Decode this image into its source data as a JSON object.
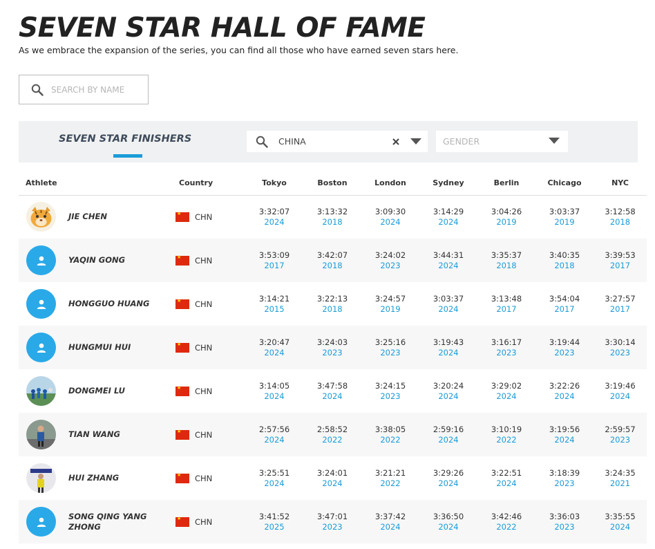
{
  "header": {
    "title": "SEVEN STAR HALL OF FAME",
    "subtitle": "As we embrace the expansion of the series, you can find all those who have earned seven stars here."
  },
  "search": {
    "placeholder": "SEARCH BY NAME",
    "icon": "search-icon"
  },
  "filters": {
    "section_tab": "SEVEN STAR FINISHERS",
    "country": {
      "value": "CHINA",
      "icon": "search-icon"
    },
    "gender": {
      "placeholder": "GENDER"
    }
  },
  "colors": {
    "accent": "#1a9cd8",
    "avatar_default": "#2aa9e8",
    "flag_red": "#de2910"
  },
  "table": {
    "headers": {
      "athlete": "Athlete",
      "country": "Country",
      "tokyo": "Tokyo",
      "boston": "Boston",
      "london": "London",
      "sydney": "Sydney",
      "berlin": "Berlin",
      "chicago": "Chicago",
      "nyc": "NYC"
    },
    "rows": [
      {
        "name": "JIE CHEN",
        "avatar": "tiger-avatar",
        "country": "CHN",
        "results": [
          {
            "time": "3:32:07",
            "year": "2024"
          },
          {
            "time": "3:13:32",
            "year": "2018"
          },
          {
            "time": "3:09:30",
            "year": "2024"
          },
          {
            "time": "3:14:29",
            "year": "2024"
          },
          {
            "time": "3:04:26",
            "year": "2019"
          },
          {
            "time": "3:03:37",
            "year": "2019"
          },
          {
            "time": "3:12:58",
            "year": "2018"
          }
        ]
      },
      {
        "name": "YAQIN GONG",
        "avatar": "default-user-avatar",
        "country": "CHN",
        "results": [
          {
            "time": "3:53:09",
            "year": "2017"
          },
          {
            "time": "3:42:07",
            "year": "2018"
          },
          {
            "time": "3:24:02",
            "year": "2023"
          },
          {
            "time": "3:44:31",
            "year": "2024"
          },
          {
            "time": "3:35:37",
            "year": "2018"
          },
          {
            "time": "3:40:35",
            "year": "2018"
          },
          {
            "time": "3:39:53",
            "year": "2017"
          }
        ]
      },
      {
        "name": "HONGGUO HUANG",
        "avatar": "default-user-avatar",
        "country": "CHN",
        "results": [
          {
            "time": "3:14:21",
            "year": "2015"
          },
          {
            "time": "3:22:13",
            "year": "2018"
          },
          {
            "time": "3:24:57",
            "year": "2019"
          },
          {
            "time": "3:03:37",
            "year": "2024"
          },
          {
            "time": "3:13:48",
            "year": "2017"
          },
          {
            "time": "3:54:04",
            "year": "2017"
          },
          {
            "time": "3:27:57",
            "year": "2017"
          }
        ]
      },
      {
        "name": "HUNGMUI HUI",
        "avatar": "default-user-avatar",
        "country": "CHN",
        "results": [
          {
            "time": "3:20:47",
            "year": "2024"
          },
          {
            "time": "3:24:03",
            "year": "2023"
          },
          {
            "time": "3:25:16",
            "year": "2023"
          },
          {
            "time": "3:19:43",
            "year": "2024"
          },
          {
            "time": "3:16:17",
            "year": "2023"
          },
          {
            "time": "3:19:44",
            "year": "2023"
          },
          {
            "time": "3:30:14",
            "year": "2023"
          }
        ]
      },
      {
        "name": "DONGMEI LU",
        "avatar": "photo-avatar",
        "country": "CHN",
        "results": [
          {
            "time": "3:14:05",
            "year": "2024"
          },
          {
            "time": "3:47:58",
            "year": "2024"
          },
          {
            "time": "3:24:15",
            "year": "2023"
          },
          {
            "time": "3:20:24",
            "year": "2024"
          },
          {
            "time": "3:29:02",
            "year": "2024"
          },
          {
            "time": "3:22:26",
            "year": "2024"
          },
          {
            "time": "3:19:46",
            "year": "2024"
          }
        ]
      },
      {
        "name": "TIAN WANG",
        "avatar": "photo-avatar",
        "country": "CHN",
        "results": [
          {
            "time": "2:57:56",
            "year": "2024"
          },
          {
            "time": "2:58:52",
            "year": "2022"
          },
          {
            "time": "3:38:05",
            "year": "2022"
          },
          {
            "time": "2:59:16",
            "year": "2024"
          },
          {
            "time": "3:10:19",
            "year": "2022"
          },
          {
            "time": "3:19:56",
            "year": "2024"
          },
          {
            "time": "2:59:57",
            "year": "2023"
          }
        ]
      },
      {
        "name": "HUI ZHANG",
        "avatar": "photo-avatar",
        "country": "CHN",
        "results": [
          {
            "time": "3:25:51",
            "year": "2024"
          },
          {
            "time": "3:24:01",
            "year": "2024"
          },
          {
            "time": "3:21:21",
            "year": "2022"
          },
          {
            "time": "3:29:26",
            "year": "2024"
          },
          {
            "time": "3:22:51",
            "year": "2024"
          },
          {
            "time": "3:18:39",
            "year": "2023"
          },
          {
            "time": "3:24:35",
            "year": "2021"
          }
        ]
      },
      {
        "name": "SONG QING YANG ZHONG",
        "avatar": "default-user-avatar",
        "country": "CHN",
        "results": [
          {
            "time": "3:41:52",
            "year": "2025"
          },
          {
            "time": "3:47:01",
            "year": "2023"
          },
          {
            "time": "3:37:42",
            "year": "2024"
          },
          {
            "time": "3:36:50",
            "year": "2024"
          },
          {
            "time": "3:42:46",
            "year": "2022"
          },
          {
            "time": "3:36:03",
            "year": "2023"
          },
          {
            "time": "3:35:55",
            "year": "2024"
          }
        ]
      }
    ]
  }
}
